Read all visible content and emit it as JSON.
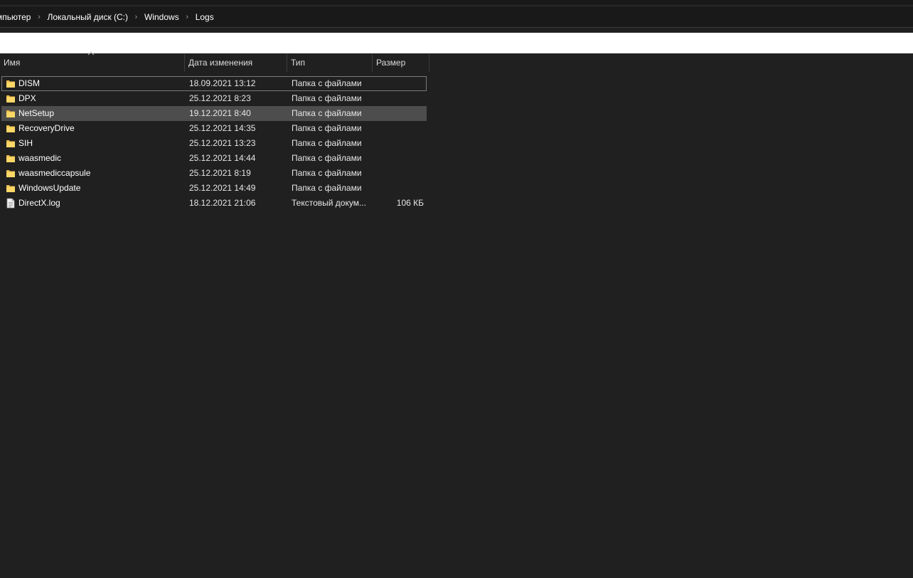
{
  "breadcrumb": [
    "мпьютер",
    "Локальный диск (C:)",
    "Windows",
    "Logs"
  ],
  "columns": {
    "name": "Имя",
    "date": "Дата изменения",
    "type": "Тип",
    "size": "Размер"
  },
  "files": [
    {
      "name": "DISM",
      "date": "18.09.2021 13:12",
      "type": "Папка с файлами",
      "size": "",
      "icon": "folder-icon"
    },
    {
      "name": "DPX",
      "date": "25.12.2021 8:23",
      "type": "Папка с файлами",
      "size": "",
      "icon": "folder-icon"
    },
    {
      "name": "NetSetup",
      "date": "19.12.2021 8:40",
      "type": "Папка с файлами",
      "size": "",
      "icon": "folder-icon"
    },
    {
      "name": "RecoveryDrive",
      "date": "25.12.2021 14:35",
      "type": "Папка с файлами",
      "size": "",
      "icon": "folder-icon"
    },
    {
      "name": "SIH",
      "date": "25.12.2021 13:23",
      "type": "Папка с файлами",
      "size": "",
      "icon": "folder-icon"
    },
    {
      "name": "waasmedic",
      "date": "25.12.2021 14:44",
      "type": "Папка с файлами",
      "size": "",
      "icon": "folder-icon"
    },
    {
      "name": "waasmediccapsule",
      "date": "25.12.2021 8:19",
      "type": "Папка с файлами",
      "size": "",
      "icon": "folder-icon"
    },
    {
      "name": "WindowsUpdate",
      "date": "25.12.2021 14:49",
      "type": "Папка с файлами",
      "size": "",
      "icon": "folder-icon"
    },
    {
      "name": "DirectX.log",
      "date": "18.12.2021 21:06",
      "type": "Текстовый докум...",
      "size": "106 КБ",
      "icon": "text-document-icon"
    }
  ],
  "state": {
    "focused_row": "DISM",
    "selected_row": "NetSetup",
    "sort_column": "Имя"
  }
}
